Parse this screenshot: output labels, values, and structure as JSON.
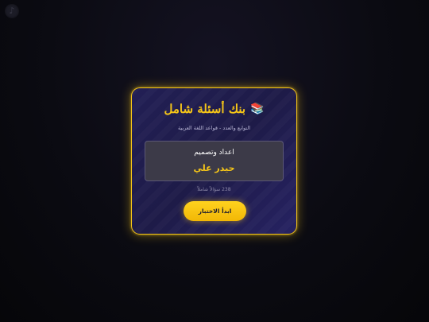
{
  "corner": {
    "icon": "music-note-icon",
    "glyph": "♪"
  },
  "card": {
    "title": "بنك أسئلة شامل",
    "title_icon": "books-icon",
    "title_icon_glyph": "📚",
    "subtitle": "التوابع والعدد - قواعد اللغة العربية",
    "author_label": "اعداد وتصميم",
    "author_name": "حيدر علي",
    "question_count": "238 سؤالاً شاملاً",
    "start_label": "ابدأ الاختبار"
  },
  "colors": {
    "accent": "#f5c518",
    "card_background": "#221f55",
    "page_background": "#0b0b12"
  }
}
